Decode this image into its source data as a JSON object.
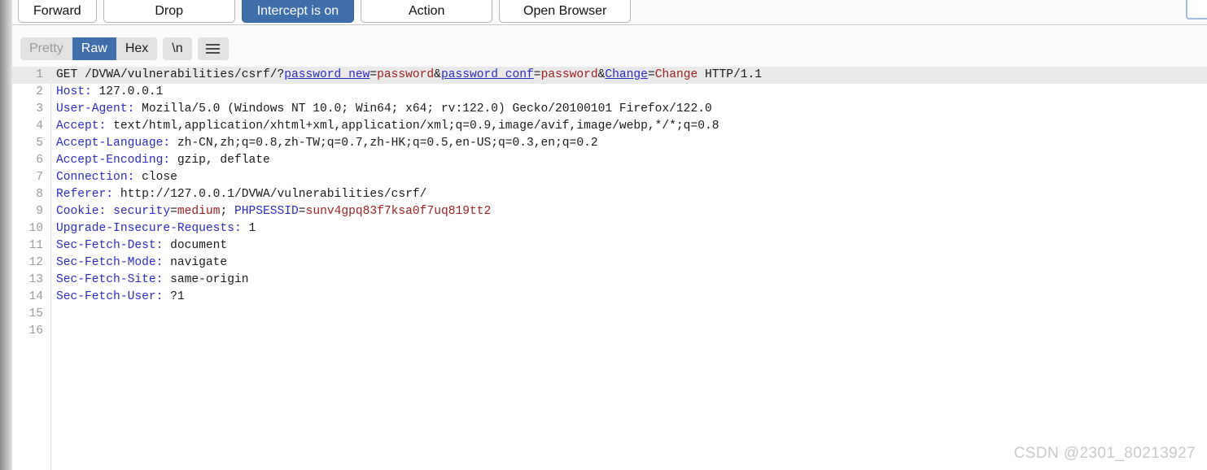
{
  "toolbar": {
    "buttons": [
      {
        "label": "Forward",
        "style": "default"
      },
      {
        "label": "Drop",
        "style": "default"
      },
      {
        "label": "Intercept is on",
        "style": "primary"
      },
      {
        "label": "Action",
        "style": "default"
      },
      {
        "label": "Open Browser",
        "style": "primary_none"
      }
    ]
  },
  "viewbar": {
    "modes": [
      {
        "label": "Pretty",
        "state": "muted"
      },
      {
        "label": "Raw",
        "state": "active"
      },
      {
        "label": "Hex",
        "state": "normal"
      }
    ],
    "newline_label": "\\n",
    "menu_icon": "hamburger-icon"
  },
  "colors": {
    "accent_blue": "#3f6fab",
    "header_name": "#2b2bc4",
    "header_value": "#1a1a1a",
    "param_value": "#9e2020",
    "line_highlight": "#e9e9e9",
    "gutter_text": "#9b9b9b",
    "watermark": "#c9c9c9"
  },
  "editor": {
    "request": {
      "method": "GET",
      "path": "/DVWA/vulnerabilities/csrf/",
      "version": "HTTP/1.1",
      "query_params": [
        {
          "name": "password_new",
          "value": "password"
        },
        {
          "name": "password_conf",
          "value": "password"
        },
        {
          "name": "Change",
          "value": "Change"
        }
      ],
      "headers": [
        {
          "name": "Host",
          "value": "127.0.0.1"
        },
        {
          "name": "User-Agent",
          "value": "Mozilla/5.0 (Windows NT 10.0; Win64; x64; rv:122.0) Gecko/20100101 Firefox/122.0"
        },
        {
          "name": "Accept",
          "value": "text/html,application/xhtml+xml,application/xml;q=0.9,image/avif,image/webp,*/*;q=0.8"
        },
        {
          "name": "Accept-Language",
          "value": "zh-CN,zh;q=0.8,zh-TW;q=0.7,zh-HK;q=0.5,en-US;q=0.3,en;q=0.2"
        },
        {
          "name": "Accept-Encoding",
          "value": "gzip, deflate"
        },
        {
          "name": "Connection",
          "value": "close"
        },
        {
          "name": "Referer",
          "value": "http://127.0.0.1/DVWA/vulnerabilities/csrf/"
        },
        {
          "name": "Upgrade-Insecure-Requests",
          "value": "1"
        },
        {
          "name": "Sec-Fetch-Dest",
          "value": "document"
        },
        {
          "name": "Sec-Fetch-Mode",
          "value": "navigate"
        },
        {
          "name": "Sec-Fetch-Site",
          "value": "same-origin"
        },
        {
          "name": "Sec-Fetch-User",
          "value": "?1"
        }
      ],
      "cookies": [
        {
          "name": "security",
          "value": "medium"
        },
        {
          "name": "PHPSESSID",
          "value": "sunv4gpq83f7ksa0f7uq819tt2"
        }
      ],
      "cookie_header_name": "Cookie",
      "blank_lines_after": 2
    },
    "line_numbers": [
      1,
      2,
      3,
      4,
      5,
      6,
      7,
      8,
      9,
      10,
      11,
      12,
      13,
      14,
      15,
      16
    ]
  },
  "watermark": {
    "text": "CSDN @2301_80213927"
  }
}
